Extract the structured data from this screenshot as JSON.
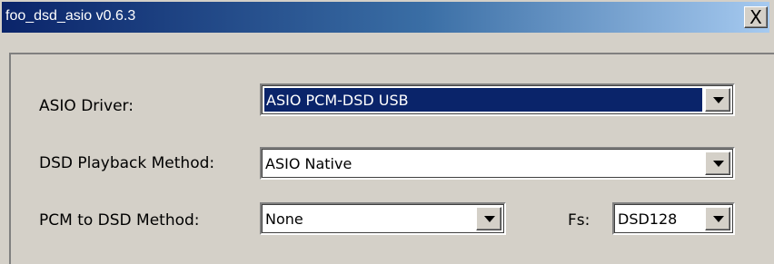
{
  "window": {
    "title": "foo_dsd_asio v0.6.3",
    "close_label": "X"
  },
  "form": {
    "asio_driver": {
      "label": "ASIO Driver:",
      "value": "ASIO PCM-DSD USB"
    },
    "dsd_playback_method": {
      "label": "DSD Playback Method:",
      "value": "ASIO Native"
    },
    "pcm_to_dsd_method": {
      "label": "PCM to DSD Method:",
      "value": "None"
    },
    "fs": {
      "label": "Fs:",
      "value": "DSD128"
    }
  },
  "icons": {
    "dropdown": "chevron-down-icon",
    "close": "close-icon"
  },
  "colors": {
    "titlebar_start": "#0a246a",
    "titlebar_end": "#a6caf0",
    "selection": "#0a246a",
    "face": "#d4d0c8"
  }
}
